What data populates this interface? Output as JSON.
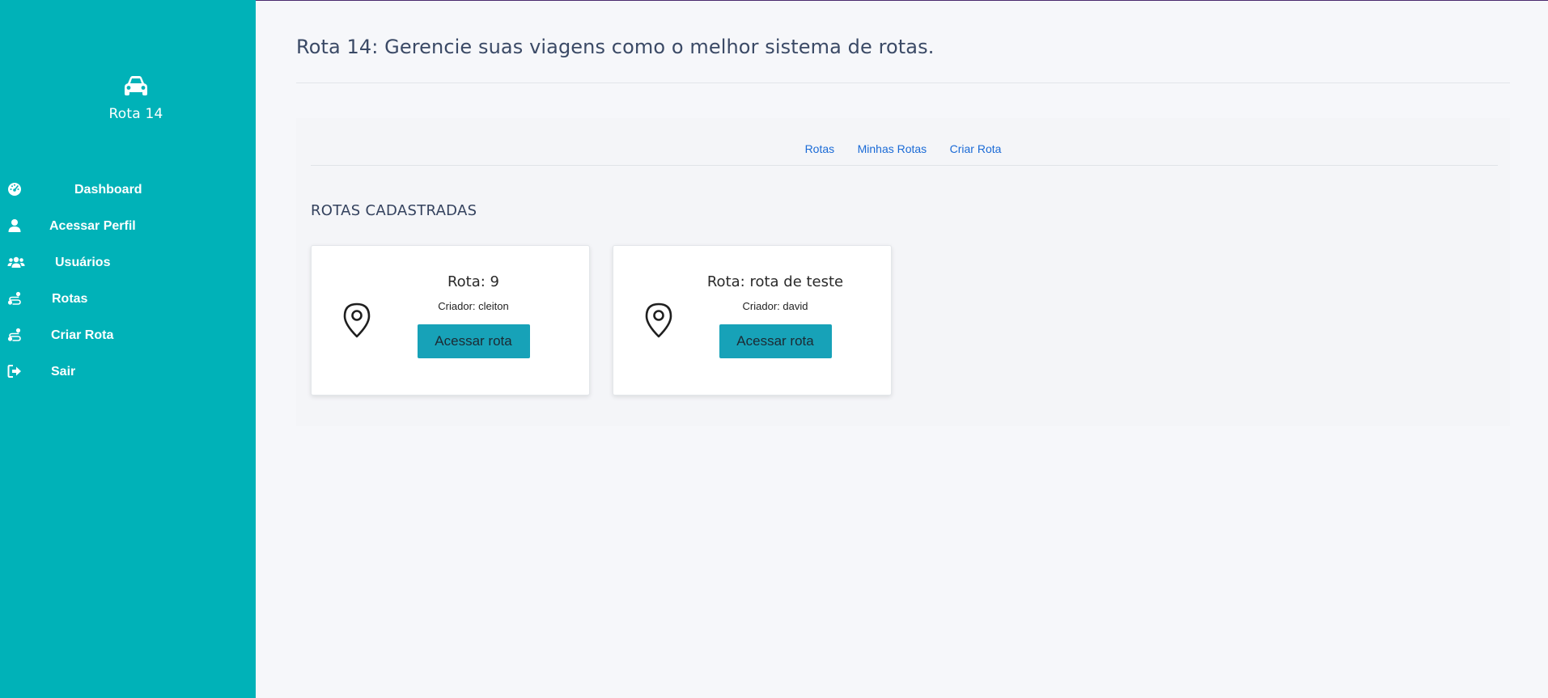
{
  "sidebar": {
    "brand": {
      "icon": "car-icon",
      "name": "Rota 14"
    },
    "items": [
      {
        "icon": "dashboard-icon",
        "label": "Dashboard"
      },
      {
        "icon": "user-icon",
        "label": "Acessar Perfil"
      },
      {
        "icon": "users-icon",
        "label": "Usuários"
      },
      {
        "icon": "route-icon",
        "label": "Rotas"
      },
      {
        "icon": "route-icon",
        "label": "Criar Rota"
      },
      {
        "icon": "sign-out-icon",
        "label": "Sair"
      }
    ]
  },
  "header": {
    "title": "Rota 14: Gerencie suas viagens como o melhor sistema de rotas."
  },
  "tabs": [
    {
      "label": "Rotas"
    },
    {
      "label": "Minhas Rotas"
    },
    {
      "label": "Criar Rota"
    }
  ],
  "section": {
    "title": "ROTAS CADASTRADAS"
  },
  "routes": [
    {
      "icon": "map-pin-icon",
      "title": "Rota: 9",
      "creator": "Criador: cleiton",
      "button_label": "Acessar rota"
    },
    {
      "icon": "map-pin-icon",
      "title": "Rota: rota de teste",
      "creator": "Criador: david",
      "button_label": "Acessar rota"
    }
  ],
  "colors": {
    "sidebar": "#00b2b8",
    "accent_button": "#17a2b8",
    "link": "#1a6ad6",
    "page_background": "#f6f7fa"
  }
}
